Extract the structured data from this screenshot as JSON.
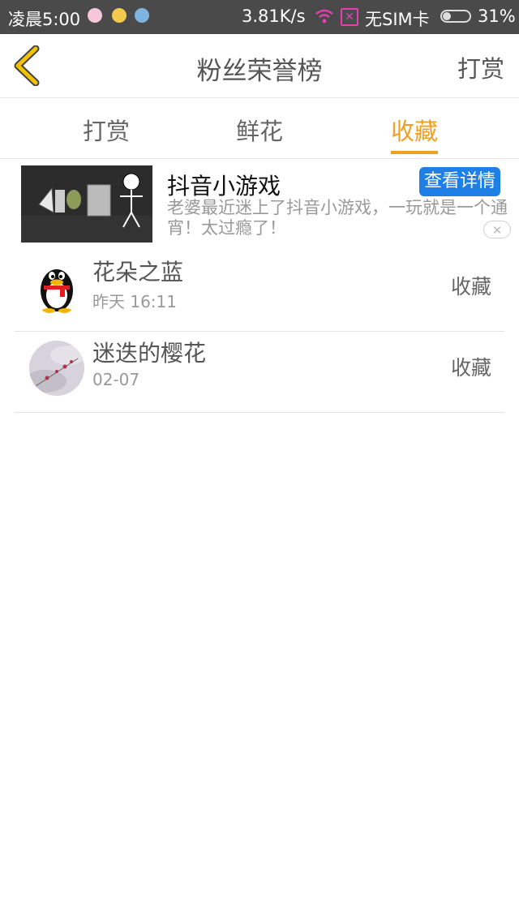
{
  "status_bar": {
    "time": "凌晨5:00",
    "net_speed": "3.81K/s",
    "sim_text": "无SIM卡",
    "battery": "31%",
    "battery_level": 0.31,
    "icons": [
      "notification-app-icon",
      "notification-app-icon",
      "notification-app-icon",
      "wifi-icon",
      "no-sim-icon",
      "battery-icon"
    ]
  },
  "header": {
    "back_icon": "chevron-left-icon",
    "title": "粉丝荣誉榜",
    "right_action": "打赏"
  },
  "tabs": [
    {
      "label": "打赏",
      "active": false
    },
    {
      "label": "鲜花",
      "active": false
    },
    {
      "label": "收藏",
      "active": true
    }
  ],
  "ad": {
    "title": "抖音小游戏",
    "button": "查看详情",
    "description": "老婆最近迷上了抖音小游戏，一玩就是一个通宵！太过瘾了！",
    "close_icon": "close-icon"
  },
  "list": [
    {
      "name": "花朵之蓝",
      "time": "昨天 16:11",
      "action": "收藏",
      "avatar": "qq-penguin-avatar"
    },
    {
      "name": "迷迭的樱花",
      "time": "02-07",
      "action": "收藏",
      "avatar": "blossom-photo-avatar"
    }
  ],
  "colors": {
    "accent": "#f0a020",
    "status_bar_bg": "#4a4a4a",
    "ad_button": "#1e80e6",
    "back_arrow": "#f3c200"
  }
}
